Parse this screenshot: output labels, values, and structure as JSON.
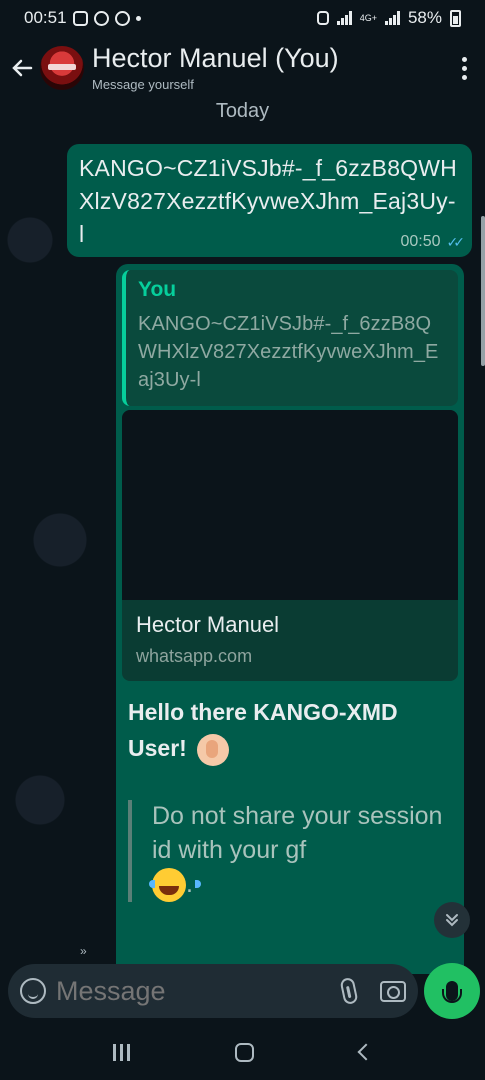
{
  "status_bar": {
    "time": "00:51",
    "battery": "58%",
    "network": "4G+"
  },
  "header": {
    "back_icon": "arrow-left-icon",
    "contact_name": "Hector Manuel (You)",
    "subtitle": "Message yourself",
    "menu_icon": "more-vert-icon"
  },
  "chat": {
    "date_label": "Today",
    "messages": [
      {
        "text": "KANGO~CZ1iVSJb#-_f_6zzB8QWHXlzV827XezztfKyvweXJhm_Eaj3Uy-l",
        "time": "00:50",
        "status": "read"
      }
    ],
    "reply_message": {
      "quoted_author": "You",
      "quoted_text": "KANGO~CZ1iVSJb#-_f_6zzB8QWHXlzV827XezztfKyvweXJhm_Eaj3Uy-l",
      "link_preview": {
        "title": "Hector Manuel",
        "url": "whatsapp.com"
      },
      "greeting": "Hello there KANGO-XMD User!",
      "quote_block": "Do not share your session id with your gf",
      "quote_suffix": "."
    }
  },
  "composer": {
    "placeholder": "Message",
    "emoji_icon": "emoji-icon",
    "attach_icon": "paperclip-icon",
    "camera_icon": "camera-icon",
    "mic_icon": "mic-icon"
  },
  "colors": {
    "background": "#0b141a",
    "outgoing_bubble": "#005c4b",
    "accent": "#06cf9c",
    "mic_button": "#21c063",
    "read_ticks": "#53bdeb"
  }
}
